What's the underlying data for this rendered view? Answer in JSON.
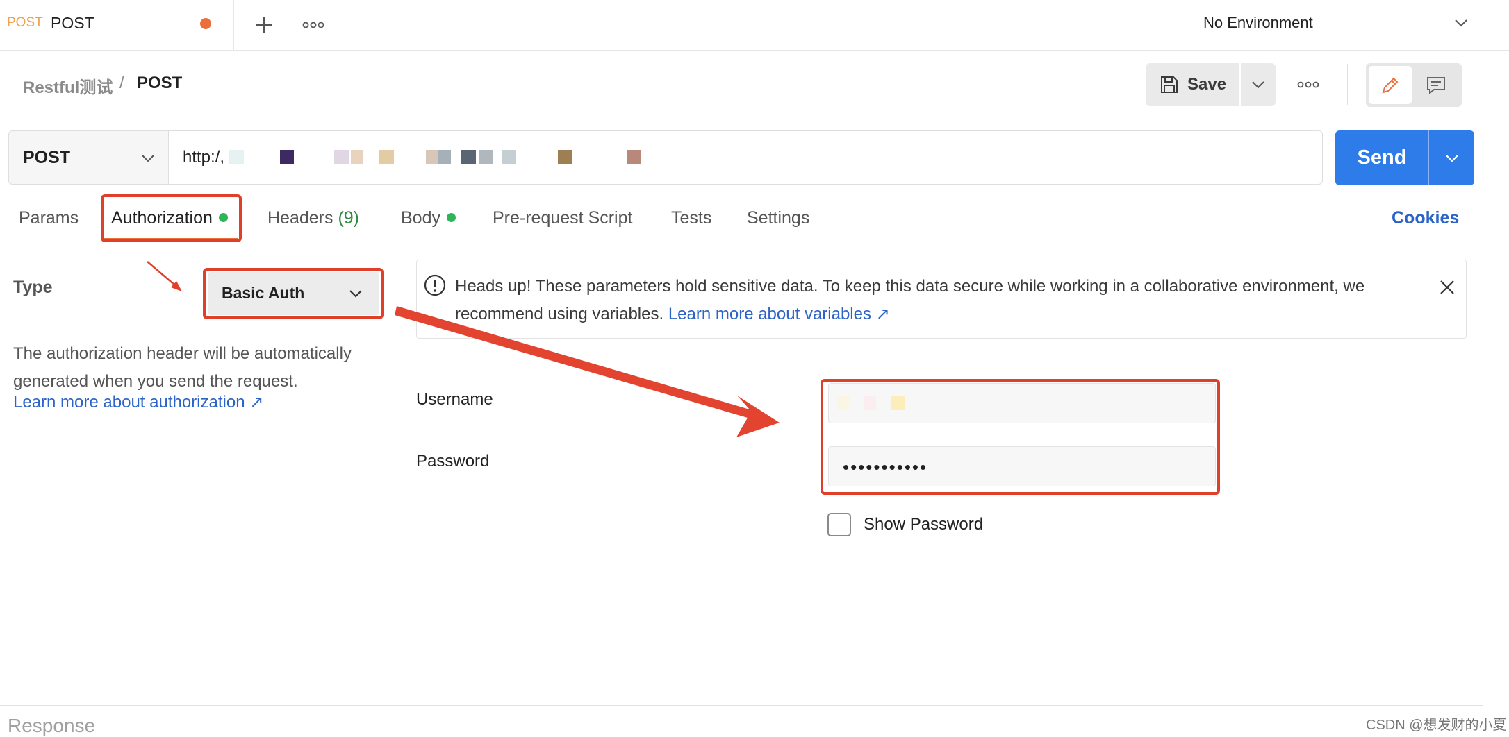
{
  "top_tab": {
    "method": "POST",
    "title": "POST"
  },
  "environment": {
    "selected": "No Environment"
  },
  "breadcrumb": {
    "parent": "Restful测试",
    "separator": "/",
    "current": "POST"
  },
  "toolbar": {
    "save_label": "Save"
  },
  "request": {
    "method": "POST",
    "url_visible": "http:/,",
    "send_label": "Send"
  },
  "request_tabs": {
    "params": "Params",
    "authorization": "Authorization",
    "headers": "Headers",
    "headers_count": "(9)",
    "body": "Body",
    "prerequest": "Pre-request Script",
    "tests": "Tests",
    "settings": "Settings",
    "cookies": "Cookies"
  },
  "auth": {
    "type_label": "Type",
    "type_value": "Basic Auth",
    "description": "The authorization header will be automatically generated when you send the request.",
    "learn_more": "Learn more about authorization ↗"
  },
  "alert": {
    "text": "Heads up! These parameters hold sensitive data. To keep this data secure while working in a collaborative environment, we recommend using variables.",
    "link": "Learn more about variables ↗"
  },
  "credentials": {
    "username_label": "Username",
    "password_label": "Password",
    "password_masked": "•••••••••••",
    "show_password_label": "Show Password"
  },
  "response": {
    "label": "Response"
  },
  "watermark": "CSDN @想发财的小夏",
  "colors": {
    "accent_blue": "#2e7bea",
    "link_blue": "#2c63c6",
    "status_green": "#2fb45a",
    "tab_dot_orange": "#eb6e3c",
    "annotation_red": "#e0402a"
  },
  "icons": [
    "plus-icon",
    "more-icon",
    "chevron-down-icon",
    "save-icon",
    "pencil-icon",
    "comment-icon",
    "info-icon",
    "close-icon",
    "arrow-icon"
  ]
}
